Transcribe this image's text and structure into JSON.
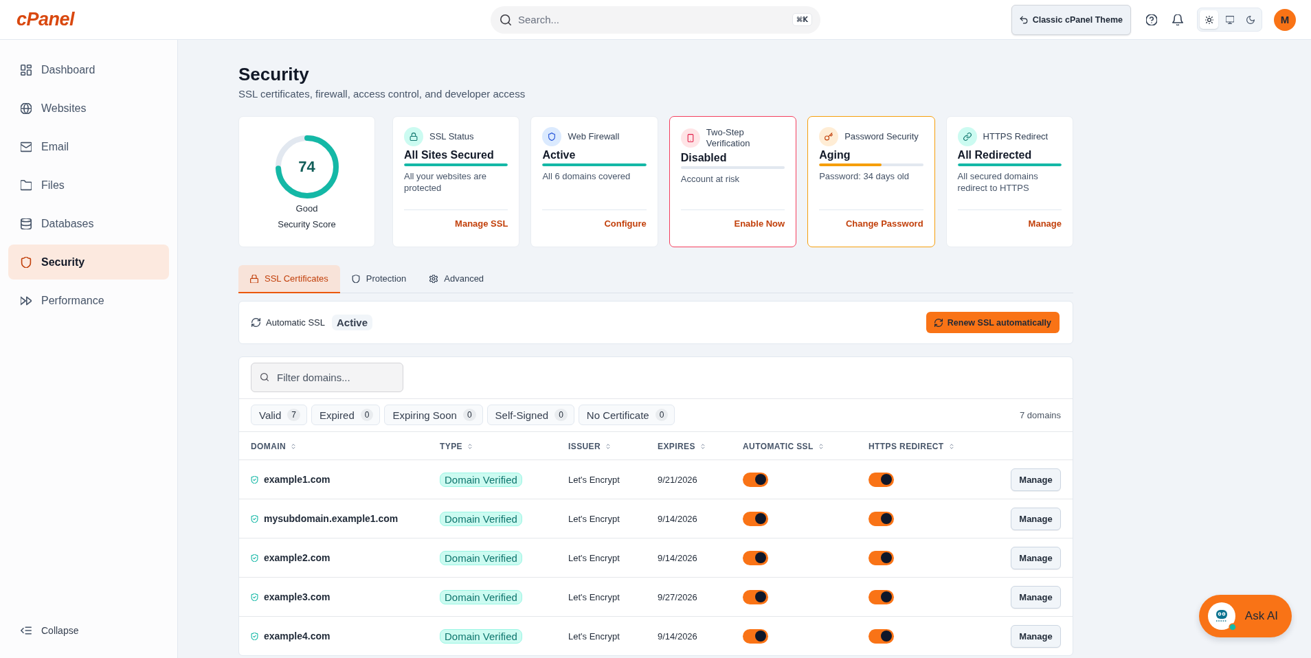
{
  "header": {
    "logo": "cPanel",
    "search": {
      "placeholder": "Search...",
      "shortcut": "⌘K"
    },
    "theme_button": "Classic cPanel Theme",
    "theme_modes": [
      {
        "kind": "light",
        "selected": true
      },
      {
        "kind": "system",
        "selected": false
      },
      {
        "kind": "dark",
        "selected": false
      }
    ],
    "avatar": "M"
  },
  "sidebar": {
    "items": [
      {
        "label": "Dashboard",
        "kind": "dashboard",
        "selected": false
      },
      {
        "label": "Websites",
        "kind": "globe",
        "selected": false
      },
      {
        "label": "Email",
        "kind": "mail",
        "selected": false
      },
      {
        "label": "Files",
        "kind": "folder",
        "selected": false
      },
      {
        "label": "Databases",
        "kind": "database",
        "selected": false
      },
      {
        "label": "Security",
        "kind": "shield",
        "selected": true
      },
      {
        "label": "Performance",
        "kind": "forward",
        "selected": false
      }
    ],
    "collapse": "Collapse"
  },
  "page": {
    "title": "Security",
    "subtitle": "SSL certificates, firewall, access control, and developer access"
  },
  "score": {
    "value": "74",
    "level": 0.74,
    "rating": "Good",
    "label": "Security Score"
  },
  "status_cards": [
    {
      "kind": "lock",
      "title": "SSL Status",
      "value": "All Sites Secured",
      "level": 1,
      "color": "#14b8a6",
      "alert": false,
      "description": "All your websites are protected",
      "action": "Manage SSL"
    },
    {
      "kind": "shield",
      "title": "Web Firewall",
      "value": "Active",
      "level": 1,
      "color": "#14b8a6",
      "alert": false,
      "description": "All 6 domains covered",
      "action": "Configure"
    },
    {
      "kind": "phone",
      "title": "Two-Step Verification",
      "value": "Disabled",
      "level": 0,
      "color": "#f43f5e",
      "alert": true,
      "description": "Account at risk",
      "action": "Enable Now"
    },
    {
      "kind": "key",
      "title": "Password Security",
      "value": "Aging",
      "level": 0.6,
      "color": "#f59e0b",
      "alert": true,
      "description": "Password: 34 days old",
      "action": "Change Password"
    },
    {
      "kind": "link",
      "title": "HTTPS Redirect",
      "value": "All Redirected",
      "level": 1,
      "color": "#14b8a6",
      "alert": false,
      "description": "All secured domains redirect to HTTPS",
      "action": "Manage"
    }
  ],
  "tabs": [
    {
      "label": "SSL Certificates",
      "kind": "lock",
      "selected": true
    },
    {
      "label": "Protection",
      "kind": "shield",
      "selected": false
    },
    {
      "label": "Advanced",
      "kind": "gear",
      "selected": false
    }
  ],
  "automatic_ssl": {
    "label": "Automatic SSL",
    "status": "Active",
    "button": "Renew SSL automatically"
  },
  "certificates": {
    "filter_placeholder": "Filter domains...",
    "filters": [
      {
        "label": "Valid",
        "count": "7",
        "selected": false
      },
      {
        "label": "Expired",
        "count": "0",
        "selected": false
      },
      {
        "label": "Expiring Soon",
        "count": "0",
        "selected": false
      },
      {
        "label": "Self-Signed",
        "count": "0",
        "selected": false
      },
      {
        "label": "No Certificate",
        "count": "0",
        "selected": false
      }
    ],
    "total": "7 domains",
    "columns": [
      "DOMAIN",
      "TYPE",
      "ISSUER",
      "EXPIRES",
      "AUTOMATIC SSL",
      "HTTPS REDIRECT"
    ],
    "rows": [
      {
        "domain": "example1.com",
        "type": "Domain Verified",
        "issuer": "Let's Encrypt",
        "expires": "9/21/2026",
        "auto_ssl": true,
        "https_redirect": true,
        "action": "Manage"
      },
      {
        "domain": "mysubdomain.example1.com",
        "type": "Domain Verified",
        "issuer": "Let's Encrypt",
        "expires": "9/14/2026",
        "auto_ssl": true,
        "https_redirect": true,
        "action": "Manage"
      },
      {
        "domain": "example2.com",
        "type": "Domain Verified",
        "issuer": "Let's Encrypt",
        "expires": "9/14/2026",
        "auto_ssl": true,
        "https_redirect": true,
        "action": "Manage"
      },
      {
        "domain": "example3.com",
        "type": "Domain Verified",
        "issuer": "Let's Encrypt",
        "expires": "9/27/2026",
        "auto_ssl": true,
        "https_redirect": true,
        "action": "Manage"
      },
      {
        "domain": "example4.com",
        "type": "Domain Verified",
        "issuer": "Let's Encrypt",
        "expires": "9/14/2026",
        "auto_ssl": true,
        "https_redirect": true,
        "action": "Manage"
      }
    ]
  },
  "ask_ai": {
    "label": "Ask AI"
  }
}
